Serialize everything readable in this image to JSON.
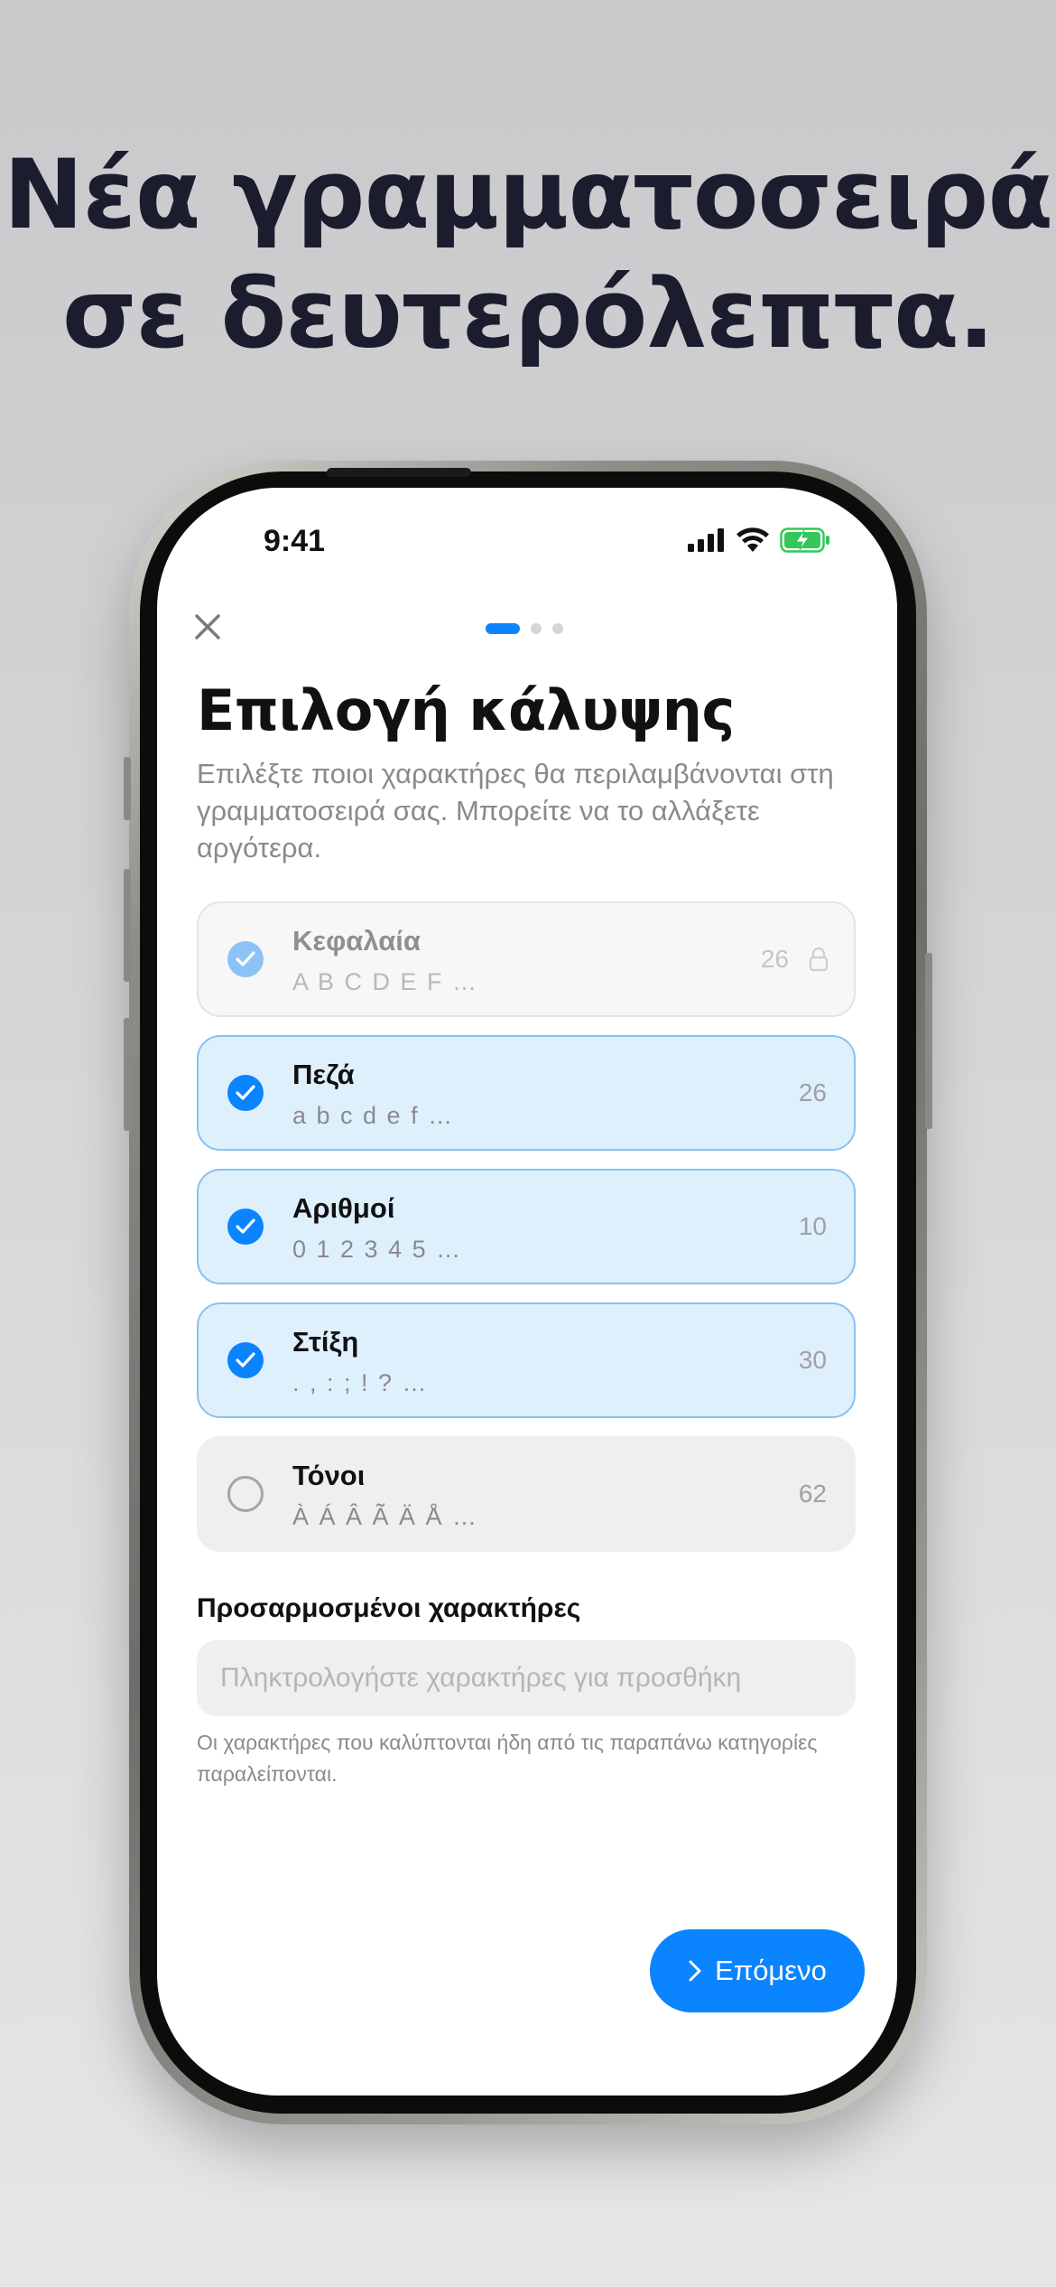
{
  "headline": {
    "line1": "Νέα γραμματοσειρά",
    "line2": "σε δευτερόλεπτα."
  },
  "status_bar": {
    "time": "9:41"
  },
  "pager": {
    "total": 3,
    "active": 0
  },
  "page": {
    "title": "Επιλογή κάλυψης",
    "subtitle": "Επιλέξτε ποιοι χαρακτήρες θα περιλαμβάνονται στη γραμματοσειρά σας. Μπορείτε να το αλλάξετε αργότερα."
  },
  "options": [
    {
      "name": "Κεφαλαία",
      "sample": "A B C D E F …",
      "count": "26",
      "state": "locked"
    },
    {
      "name": "Πεζά",
      "sample": "a b c d e f …",
      "count": "26",
      "state": "selected"
    },
    {
      "name": "Αριθμοί",
      "sample": "0 1 2 3 4 5 …",
      "count": "10",
      "state": "selected"
    },
    {
      "name": "Στίξη",
      "sample": ". , : ; ! ? …",
      "count": "30",
      "state": "selected"
    },
    {
      "name": "Τόνοι",
      "sample": "À Á Â Ã Ä Å …",
      "count": "62",
      "state": "unselected"
    }
  ],
  "custom": {
    "label": "Προσαρμοσμένοι χαρακτήρες",
    "placeholder": "Πληκτρολογήστε χαρακτήρες για προσθήκη",
    "value": "",
    "hint": "Οι χαρακτήρες που καλύπτονται ήδη από τις παραπάνω κατηγορίες παραλείπονται."
  },
  "next_button": {
    "label": "Επόμενο"
  },
  "colors": {
    "accent": "#0a84ff",
    "headline": "#1b1c2e",
    "selected_bg": "#dff0fd"
  }
}
